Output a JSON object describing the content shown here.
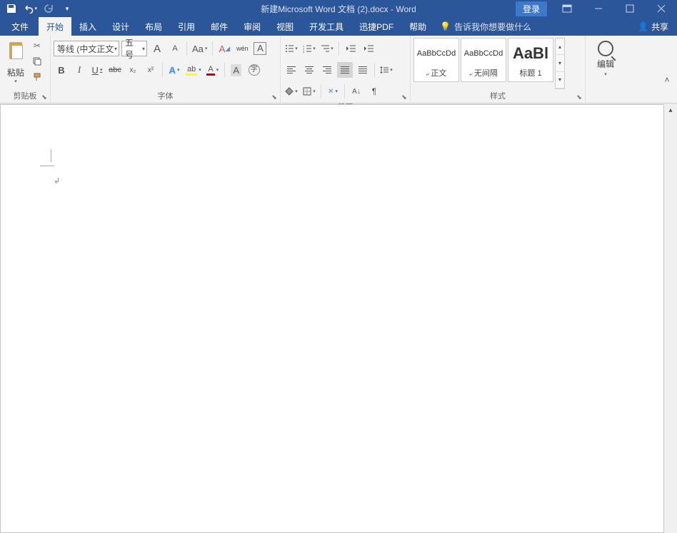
{
  "title": "新建Microsoft Word 文档 (2).docx  -  Word",
  "login": "登录",
  "tabs": {
    "file": "文件",
    "home": "开始",
    "insert": "插入",
    "design": "设计",
    "layout": "布局",
    "references": "引用",
    "mailings": "邮件",
    "review": "审阅",
    "view": "视图",
    "developer": "开发工具",
    "xunjie": "迅捷PDF",
    "help": "帮助",
    "tellme": "告诉我你想要做什么",
    "share": "共享"
  },
  "clipboard": {
    "paste": "粘贴",
    "label": "剪贴板"
  },
  "font": {
    "name": "等线 (中文正文",
    "size": "五号",
    "increase": "A",
    "decrease": "A",
    "case": "Aa",
    "clear": "A",
    "phonetic": "wén",
    "border": "A",
    "bold": "B",
    "italic": "I",
    "underline": "U",
    "strike": "abc",
    "sub": "x₂",
    "sup": "x²",
    "effect": "A",
    "highlight": "ab",
    "color": "A",
    "charshade": "A",
    "label": "字体"
  },
  "paragraph": {
    "label": "段落"
  },
  "styles": {
    "preview1": "AaBbCcDd",
    "name1": "正文",
    "preview2": "AaBbCcDd",
    "name2": "无间隔",
    "preview3": "AaBl",
    "name3": "标题 1",
    "label": "样式"
  },
  "edit": {
    "label": "编辑"
  }
}
